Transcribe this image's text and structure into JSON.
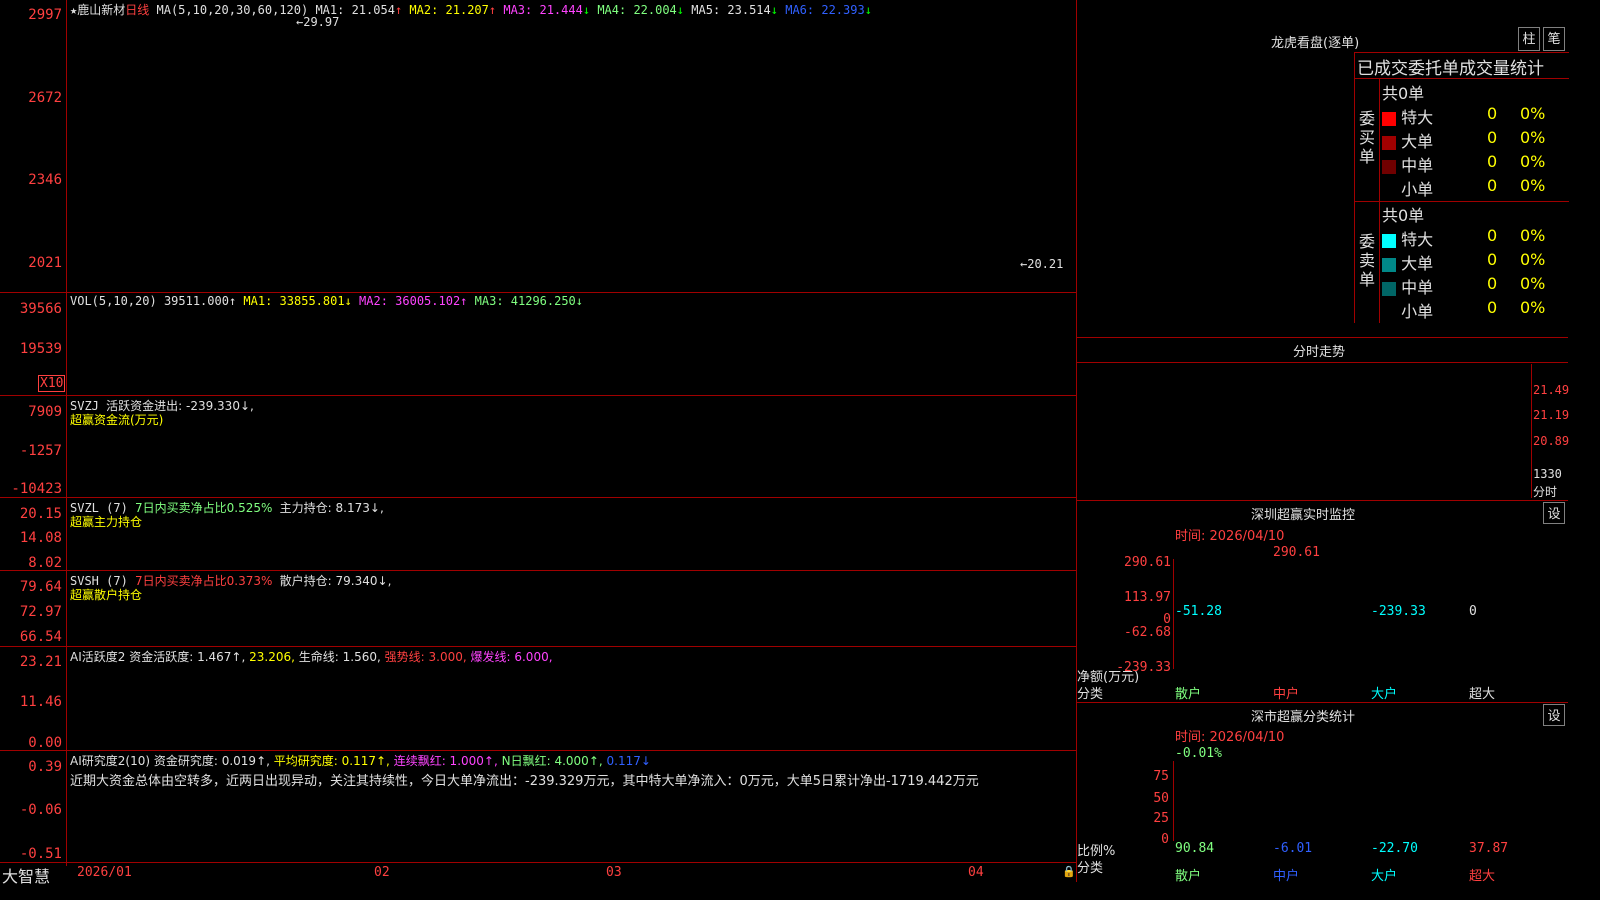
{
  "main_chart": {
    "stock_name": "鹿山新材",
    "period": "日线",
    "ma_label": "MA(5,10,20,30,60,120)",
    "ma": [
      {
        "name": "MA1",
        "value": "21.054",
        "dir": "↑",
        "color": "#ffffff"
      },
      {
        "name": "MA2",
        "value": "21.207",
        "dir": "↑",
        "color": "#ffff00"
      },
      {
        "name": "MA3",
        "value": "21.444",
        "dir": "↓",
        "color": "#ff44ff"
      },
      {
        "name": "MA4",
        "value": "22.004",
        "dir": "↓",
        "color": "#00ff00"
      },
      {
        "name": "MA5",
        "value": "23.514",
        "dir": "↓",
        "color": "#c0c0c0"
      },
      {
        "name": "MA6",
        "value": "22.393",
        "dir": "↓",
        "color": "#3060ff"
      }
    ],
    "y_ticks": [
      "2997",
      "2672",
      "2346",
      "2021"
    ],
    "high_mark": "29.97",
    "low_mark": "20.21"
  },
  "vol_panel": {
    "label": "VOL(5,10,20)",
    "value": "39511.000↑",
    "ma1": "MA1: 33855.801↓",
    "ma2": "MA2: 36005.102↑",
    "ma3": "MA3: 41296.250↓",
    "y_ticks": [
      "39566",
      "19539"
    ],
    "multiplier": "X10"
  },
  "svzj_panel": {
    "label": "SVZJ",
    "desc": "活跃资金进出: -239.330↓,",
    "sub": "超赢资金流(万元)",
    "y_ticks": [
      "7909",
      "-1257",
      "-10423"
    ]
  },
  "svzl_panel": {
    "label": "SVZL (7)",
    "desc1": "7日内买卖净占比0.525%",
    "desc2": "主力持仓: 8.173↓,",
    "sub": "超赢主力持仓",
    "y_ticks": [
      "20.15",
      "14.08",
      "8.02"
    ]
  },
  "svsh_panel": {
    "label": "SVSH (7)",
    "desc1": "7日内买卖净占比0.373%",
    "desc2": "散户持仓: 79.340↓,",
    "sub": "超赢散户持仓",
    "y_ticks": [
      "79.64",
      "72.97",
      "66.54"
    ]
  },
  "ai_active_panel": {
    "label": "AI活跃度2",
    "fund": "资金活跃度: 1.467↑,",
    "v2": "23.206,",
    "life": "生命线: 1.560,",
    "strong": "强势线: 3.000,",
    "burst": "爆发线: 6.000,",
    "y_ticks": [
      "23.21",
      "11.46",
      "0.00"
    ]
  },
  "ai_research_panel": {
    "label": "AI研究度2(10)",
    "fund": "资金研究度: 0.019↑,",
    "avg": "平均研究度: 0.117↑,",
    "cont": "连续飘红: 1.000↑,",
    "n_days": "N日飘红: 4.000↑,",
    "last": "0.117↓",
    "comment": "近期大资金总体由空转多，近两日出现异动，关注其持续性，今日大单净流出：-239.329万元，其中特大单净流入：0万元，大单5日累计净出-1719.442万元",
    "y_ticks": [
      "0.39",
      "-0.06",
      "-0.51"
    ]
  },
  "x_axis": {
    "brand": "大智慧",
    "labels": [
      "2026/01",
      "02",
      "03",
      "04"
    ]
  },
  "dragon_tiger": {
    "title": "龙虎看盘(逐单)",
    "btn1": "柱",
    "btn2": "笔",
    "header": "已成交委托单成交量统计",
    "buy_total": "共0单",
    "sell_total": "共0单",
    "buy_label": "委买单",
    "sell_label": "委卖单",
    "buy_rows": [
      {
        "name": "特大",
        "count": "0",
        "pct": "0%",
        "color": "#ff0000"
      },
      {
        "name": "大单",
        "count": "0",
        "pct": "0%",
        "color": "#a00000"
      },
      {
        "name": "中单",
        "count": "0",
        "pct": "0%",
        "color": "#700000"
      },
      {
        "name": "小单",
        "count": "0",
        "pct": "0%",
        "color": "#000000"
      }
    ],
    "sell_rows": [
      {
        "name": "特大",
        "count": "0",
        "pct": "0%",
        "color": "#00ffff"
      },
      {
        "name": "大单",
        "count": "0",
        "pct": "0%",
        "color": "#008888"
      },
      {
        "name": "中单",
        "count": "0",
        "pct": "0%",
        "color": "#006666"
      },
      {
        "name": "小单",
        "count": "0",
        "pct": "0%",
        "color": "#000000"
      }
    ]
  },
  "intraday": {
    "title": "分时走势",
    "y_ticks": [
      "21.49",
      "21.19",
      "20.89"
    ],
    "vol_tick": "1330",
    "vol_label": "分时"
  },
  "sz_monitor": {
    "title": "深圳超赢实时监控",
    "btn": "设",
    "time": "时间: 2026/04/10",
    "y_ticks": [
      "290.61",
      "113.97",
      "0",
      "-62.68",
      "-239.33"
    ],
    "ylabel": "净额(万元)",
    "xlabel": "分类",
    "categories": [
      "散户",
      "中户",
      "大户",
      "超大"
    ],
    "values": [
      -51.28,
      290.61,
      -239.33,
      0
    ],
    "value_labels": [
      "-51.28",
      "290.61",
      "-239.33",
      "0"
    ]
  },
  "sz_classify": {
    "title": "深市超赢分类统计",
    "btn": "设",
    "time": "时间: 2026/04/10",
    "top_label": "-0.01%",
    "y_ticks": [
      "75",
      "50",
      "25",
      "0"
    ],
    "ylabel": "比例%",
    "xlabel": "分类",
    "categories": [
      "散户",
      "中户",
      "大户",
      "超大"
    ],
    "values": [
      90.84,
      -6.01,
      -22.7,
      37.87
    ],
    "value_labels": [
      "90.84",
      "-6.01",
      "-22.70",
      "37.87"
    ]
  }
}
